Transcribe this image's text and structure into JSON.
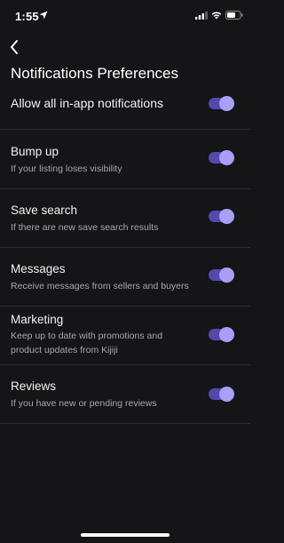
{
  "status_bar": {
    "time": "1:55",
    "icons": [
      "location-arrow-icon",
      "cellular-signal-icon",
      "wifi-icon",
      "battery-icon"
    ]
  },
  "header": {
    "back_icon": "chevron-left-icon",
    "title": "Notifications Preferences"
  },
  "allow_all": {
    "label": "Allow all in-app notifications",
    "enabled": true
  },
  "preferences": [
    {
      "title": "Bump up",
      "description": "If your listing loses visibility",
      "enabled": true
    },
    {
      "title": "Save search",
      "description": "If there are new save search results",
      "enabled": true
    },
    {
      "title": "Messages",
      "description": "Receive messages from sellers and buyers",
      "enabled": true
    },
    {
      "title": "Marketing",
      "description": "Keep up to date with promotions and product updates from Kijiji",
      "enabled": true
    },
    {
      "title": "Reviews",
      "description": "If you have new or pending reviews",
      "enabled": true
    }
  ],
  "colors": {
    "background": "#151416",
    "toggle_track": "#5548ad",
    "toggle_knob": "#a99ff6",
    "divider": "#2c2b2e",
    "secondary_text": "#a9a7ad"
  }
}
